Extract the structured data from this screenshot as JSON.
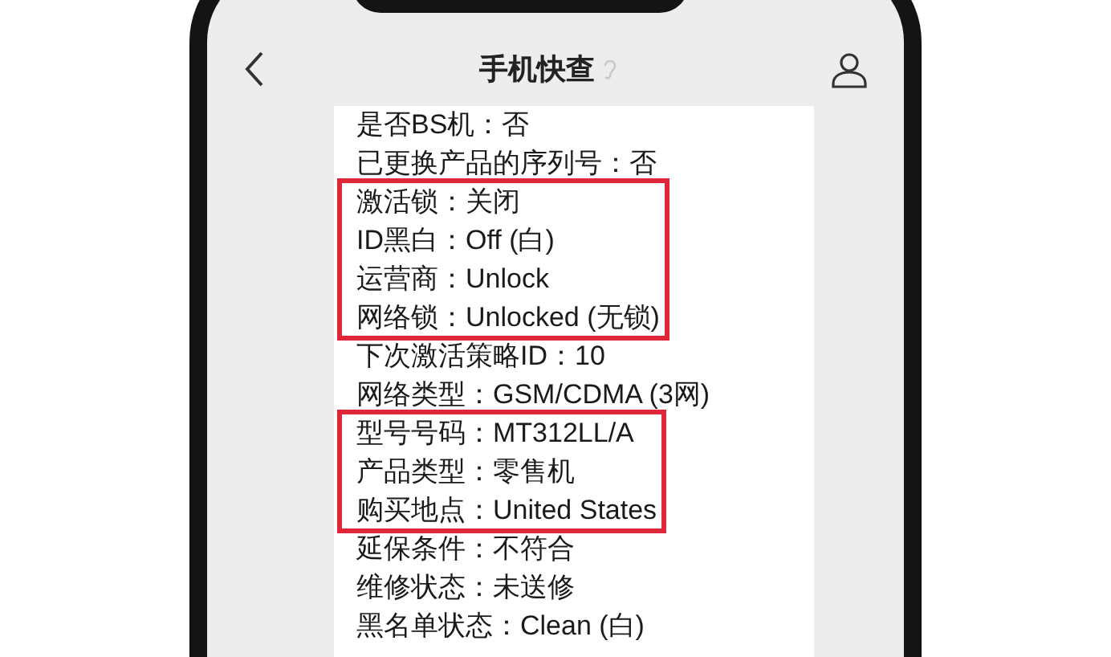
{
  "nav_bar": {
    "title": "手机快查"
  },
  "groups": [
    {
      "highlighted": false,
      "rows": [
        "是否BS机：否",
        "已更换产品的序列号：否"
      ]
    },
    {
      "highlighted": true,
      "rows": [
        "激活锁：关闭",
        "ID黑白：Off (白)",
        "运营商：Unlock",
        "网络锁：Unlocked (无锁)"
      ]
    },
    {
      "highlighted": false,
      "rows": [
        "下次激活策略ID：10",
        "网络类型：GSM/CDMA (3网)"
      ]
    },
    {
      "highlighted": true,
      "rows": [
        "型号号码：MT312LL/A",
        "产品类型：零售机",
        "购买地点：United States"
      ]
    },
    {
      "highlighted": false,
      "rows": [
        "延保条件：不符合",
        "维修状态：未送修",
        "黑名单状态：Clean (白)"
      ]
    }
  ]
}
